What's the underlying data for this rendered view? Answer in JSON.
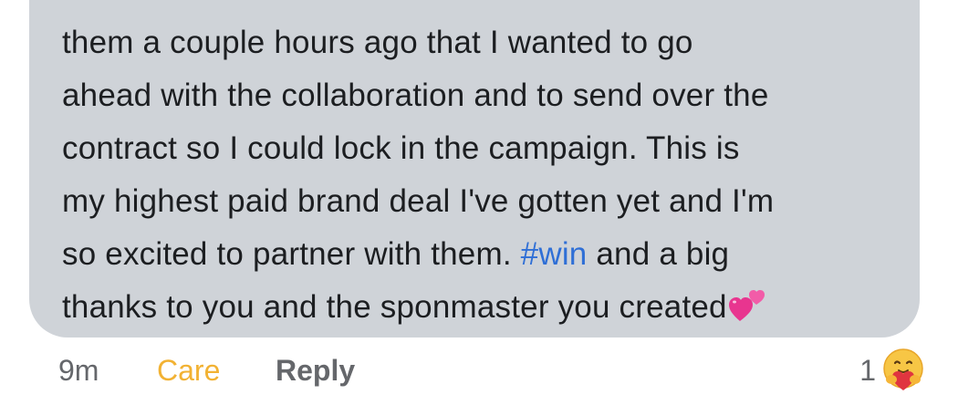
{
  "comment": {
    "lines": [
      "them a couple hours ago that I wanted to go",
      "ahead with the collaboration and to send over the",
      "contract so I  could lock in the campaign. This is",
      "my highest paid brand deal I've gotten yet and I'm",
      "so excited to partner with them. ",
      "thanks to you and the sponmaster you created"
    ],
    "hashtag": "#win",
    "after_hashtag": " and a big",
    "trailing_emoji": "two-hearts-icon"
  },
  "actions": {
    "timestamp": "9m",
    "care_label": "Care",
    "reply_label": "Reply"
  },
  "reactions": {
    "count": "1",
    "type": "care-emoji-icon"
  },
  "colors": {
    "bubble": "#cfd3d8",
    "text": "#1c1e21",
    "hashtag": "#2f6fd6",
    "care": "#f2b233",
    "muted": "#65676b"
  }
}
